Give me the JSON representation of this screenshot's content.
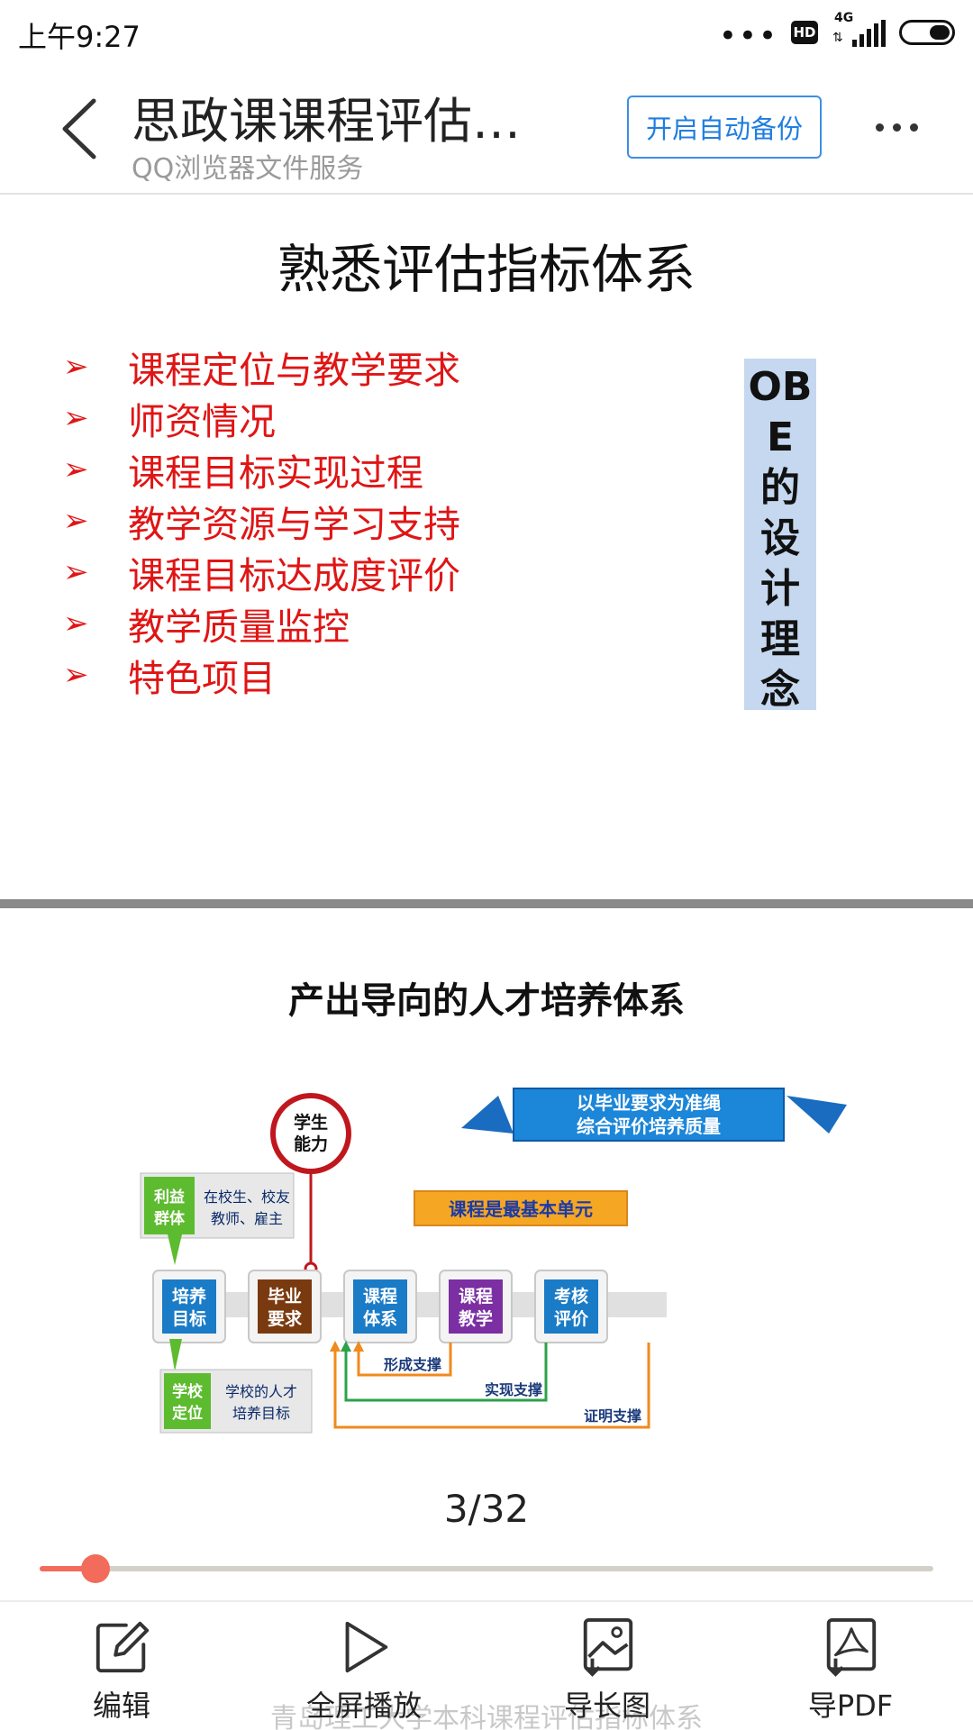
{
  "status_bar": {
    "time": "上午9:27",
    "dots": "•••",
    "hd": "HD",
    "network": "4G",
    "signal_arrows": "⇅",
    "battery_level": 0.45
  },
  "header": {
    "title": "思政课课程评估…",
    "subtitle": "QQ浏览器文件服务",
    "backup_button": "开启自动备份"
  },
  "slide1": {
    "title": "熟悉评估指标体系",
    "bullet_symbol": "➢",
    "bullets": [
      "课程定位与教学要求",
      "师资情况",
      "课程目标实现过程",
      "教学资源与学习支持",
      "课程目标达成度评价",
      "教学质量监控",
      "特色项目"
    ],
    "side_box": "OBE的设计理念"
  },
  "slide2": {
    "title": "产出导向的人才培养体系",
    "diagram": {
      "banner_line1": "以毕业要求为准绳",
      "banner_line2": "综合评价培养质量",
      "student_ability_line1": "学生",
      "student_ability_line2": "能力",
      "stakeholder_tag_line1": "利益",
      "stakeholder_tag_line2": "群体",
      "stakeholder_desc_line1": "在校生、校友",
      "stakeholder_desc_line2": "教师、雇主",
      "school_tag_line1": "学校",
      "school_tag_line2": "定位",
      "school_desc_line1": "学校的人才",
      "school_desc_line2": "培养目标",
      "course_unit": "课程是最基本单元",
      "nodes": [
        {
          "line1": "培养",
          "line2": "目标",
          "color": "#1a7bc7"
        },
        {
          "line1": "毕业",
          "line2": "要求",
          "color": "#7a3a10"
        },
        {
          "line1": "课程",
          "line2": "体系",
          "color": "#1a7bc7"
        },
        {
          "line1": "课程",
          "line2": "教学",
          "color": "#7b2fa3"
        },
        {
          "line1": "考核",
          "line2": "评价",
          "color": "#1a7bc7"
        }
      ],
      "support_1": "形成支撑",
      "support_2": "实现支撑",
      "support_3": "证明支撑"
    }
  },
  "pager": {
    "text": "3/32",
    "progress": 0.0625
  },
  "toolbar": {
    "edit": "编辑",
    "fullscreen": "全屏播放",
    "long_image": "导长图",
    "pdf": "导PDF",
    "watermark": "青岛理工大学本科课程评估指标体系"
  },
  "colors": {
    "accent_red": "#e01515",
    "accent_blue": "#1f7ee0",
    "slider": "#f36b5b"
  }
}
